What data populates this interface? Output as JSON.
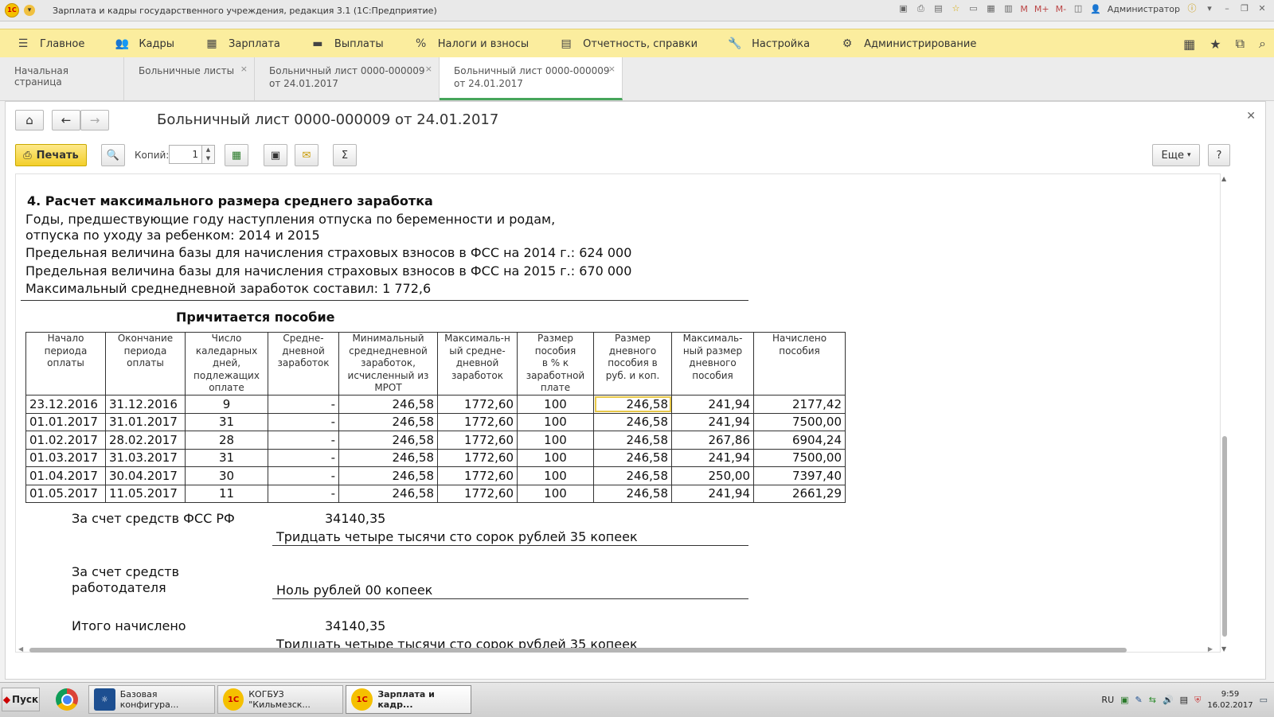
{
  "window": {
    "title": "Зарплата и кадры государственного учреждения, редакция 3.1  (1С:Предприятие)",
    "user": "Администратор",
    "memory_buttons": [
      "M",
      "M+",
      "M-"
    ]
  },
  "sections": [
    {
      "icon": "menu-icon",
      "label": "Главное"
    },
    {
      "icon": "people-icon",
      "label": "Кадры"
    },
    {
      "icon": "calculator-icon",
      "label": "Зарплата"
    },
    {
      "icon": "payments-icon",
      "label": "Выплаты"
    },
    {
      "icon": "percent-icon",
      "label": "Налоги и взносы"
    },
    {
      "icon": "report-icon",
      "label": "Отчетность, справки"
    },
    {
      "icon": "wrench-icon",
      "label": "Настройка"
    },
    {
      "icon": "gear-icon",
      "label": "Администрирование"
    }
  ],
  "tabs": [
    {
      "line1": "Начальная страница",
      "line2": ""
    },
    {
      "line1": "Больничные листы",
      "line2": ""
    },
    {
      "line1": "Больничный лист 0000-000009",
      "line2": "от 24.01.2017"
    },
    {
      "line1": "Больничный лист 0000-000009",
      "line2": "от 24.01.2017"
    }
  ],
  "form": {
    "title": "Больничный лист 0000-000009 от 24.01.2017",
    "print_label": "Печать",
    "copies_label": "Копий:",
    "copies_value": "1",
    "more_label": "Еще",
    "help_label": "?"
  },
  "report": {
    "heading": "4. Расчет максимального размера среднего заработка",
    "years_line1": "Годы, предшествующие году наступления отпуска по беременности и родам,",
    "years_line2": "отпуска по уходу за ребенком: 2014 и 2015",
    "base_2014": "Предельная величина базы для начисления страховых взносов в ФСС на 2014 г.: 624 000",
    "base_2015": "Предельная величина базы для начисления страховых взносов в ФСС на 2015 г.: 670 000",
    "max_daily": "Максимальный среднедневной заработок составил: 1 772,6",
    "benefit_title": "Причитается пособие",
    "columns": [
      [
        "Начало",
        "периода",
        "оплаты"
      ],
      [
        "Окончание",
        "периода",
        "оплаты"
      ],
      [
        "Число",
        "каледарных",
        "дней,",
        "подлежащих",
        "оплате"
      ],
      [
        "Средне-",
        "дневной",
        "заработок"
      ],
      [
        "Минимальный",
        "среднедневной",
        "заработок,",
        "исчисленный из",
        "МРОТ"
      ],
      [
        "Максималь-н",
        "ый средне-",
        "дневной",
        "заработок"
      ],
      [
        "Размер",
        "пособия",
        "в % к",
        "заработной",
        "плате"
      ],
      [
        "Размер",
        "дневного",
        "пособия в",
        "руб. и коп."
      ],
      [
        "Максималь-",
        "ный размер",
        "дневного",
        "пособия"
      ],
      [
        "Начислено",
        "пособия"
      ]
    ],
    "rows": [
      [
        "23.12.2016",
        "31.12.2016",
        "9",
        "-",
        "246,58",
        "1772,60",
        "100",
        "246,58",
        "241,94",
        "2177,42"
      ],
      [
        "01.01.2017",
        "31.01.2017",
        "31",
        "-",
        "246,58",
        "1772,60",
        "100",
        "246,58",
        "241,94",
        "7500,00"
      ],
      [
        "01.02.2017",
        "28.02.2017",
        "28",
        "-",
        "246,58",
        "1772,60",
        "100",
        "246,58",
        "267,86",
        "6904,24"
      ],
      [
        "01.03.2017",
        "31.03.2017",
        "31",
        "-",
        "246,58",
        "1772,60",
        "100",
        "246,58",
        "241,94",
        "7500,00"
      ],
      [
        "01.04.2017",
        "30.04.2017",
        "30",
        "-",
        "246,58",
        "1772,60",
        "100",
        "246,58",
        "250,00",
        "7397,40"
      ],
      [
        "01.05.2017",
        "11.05.2017",
        "11",
        "-",
        "246,58",
        "1772,60",
        "100",
        "246,58",
        "241,94",
        "2661,29"
      ]
    ],
    "fss_label": "За счет средств ФСС РФ",
    "fss_amount": "34140,35",
    "fss_words": "Тридцать четыре тысячи сто сорок рублей 35 копеек",
    "employer_label1": "За счет средств",
    "employer_label2": "работодателя",
    "employer_words": "Ноль рублей 00 копеек",
    "total_label": "Итого начислено",
    "total_amount": "34140,35",
    "total_words": "Тридцать четыре тысячи сто сорок рублей 35 копеек"
  },
  "taskbar": {
    "start_label": "Пуск",
    "items": [
      "Базовая конфигура...",
      "КОГБУЗ \"Кильмезск...",
      "Зарплата и кадр..."
    ],
    "lang": "RU",
    "time": "9:59",
    "date": "16.02.2017"
  }
}
